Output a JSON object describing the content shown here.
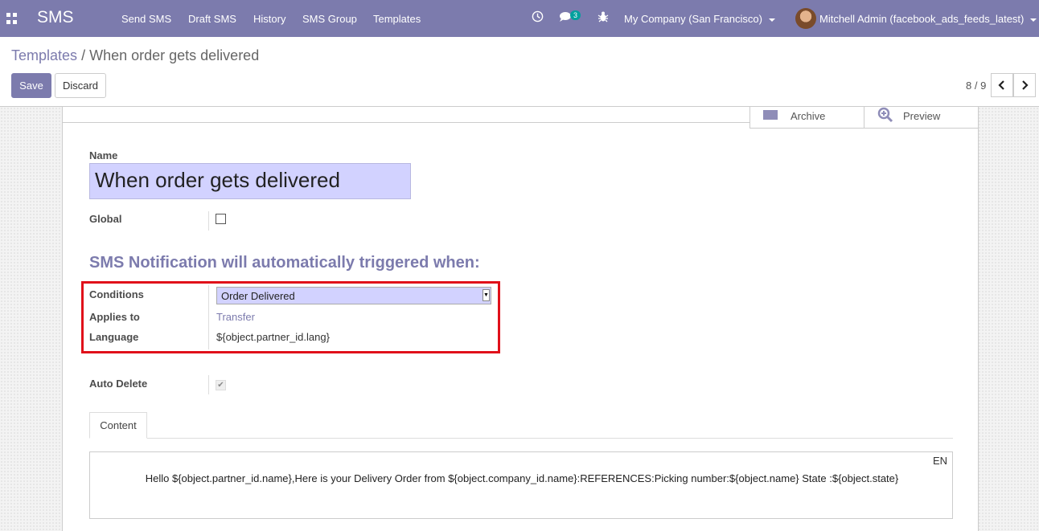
{
  "navbar": {
    "brand": "SMS",
    "menu": [
      "Send SMS",
      "Draft SMS",
      "History",
      "SMS Group",
      "Templates"
    ],
    "chat_badge": "3",
    "company": "My Company (San Francisco)",
    "user": "Mitchell Admin (facebook_ads_feeds_latest)",
    "icons": [
      "apps-icon",
      "clock-icon",
      "chat-icon",
      "bug-icon"
    ]
  },
  "breadcrumb": {
    "parent": "Templates",
    "separator": "/",
    "current": "When order gets delivered"
  },
  "actions": {
    "save": "Save",
    "discard": "Discard"
  },
  "pager": {
    "value": "8 / 9"
  },
  "button_box": {
    "archive": "Archive",
    "preview": "Preview"
  },
  "form": {
    "name_label": "Name",
    "name_value": "When order gets delivered",
    "global_label": "Global",
    "global_checked": false,
    "section_title": "SMS Notification will automatically triggered when:",
    "conditions_label": "Conditions",
    "conditions_value": "Order Delivered",
    "applies_to_label": "Applies to",
    "applies_to_value": "Transfer",
    "language_label": "Language",
    "language_value": "${object.partner_id.lang}",
    "auto_delete_label": "Auto Delete",
    "auto_delete_checked": true
  },
  "tabs": {
    "content": "Content"
  },
  "content": {
    "lang": "EN",
    "body": "Hello ${object.partner_id.name},Here is your Delivery Order from ${object.company_id.name}:REFERENCES:Picking number:${object.name} State :${object.state}"
  },
  "colors": {
    "brand": "#7c7bad",
    "field_highlight": "#d2d2ff",
    "annotation_red": "#e0101a",
    "badge": "#00a09d"
  }
}
